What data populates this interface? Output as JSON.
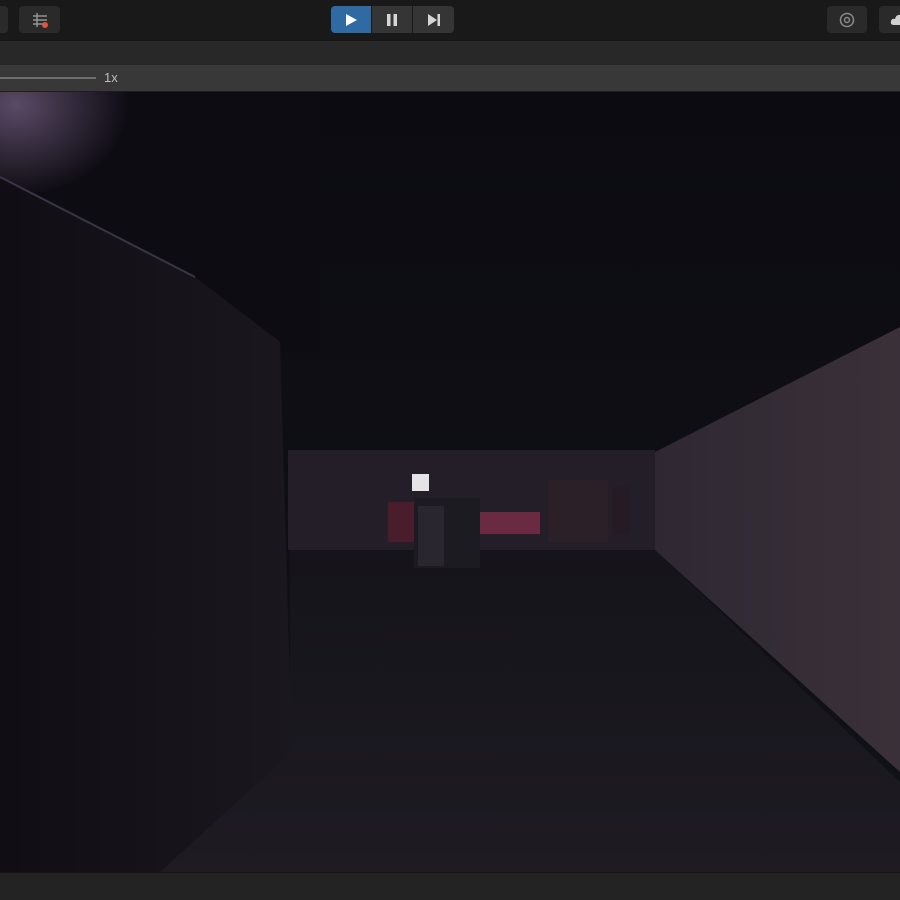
{
  "toolbar": {
    "play_icon": "play-icon",
    "pause_icon": "pause-icon",
    "step_icon": "step-icon",
    "layers_icon": "layers-icon",
    "collab_icon": "collab-icon",
    "cloud_icon": "cloud-icon",
    "play_active_color": "#2f6aa3"
  },
  "game_view": {
    "scale_label": "1x",
    "scale_value": 1
  },
  "scene": {
    "wall_color": "#2a2230",
    "floor_color": "#1d1a22",
    "accent_color": "#7a2b44",
    "crosshair_color": "#e4e4e6"
  }
}
